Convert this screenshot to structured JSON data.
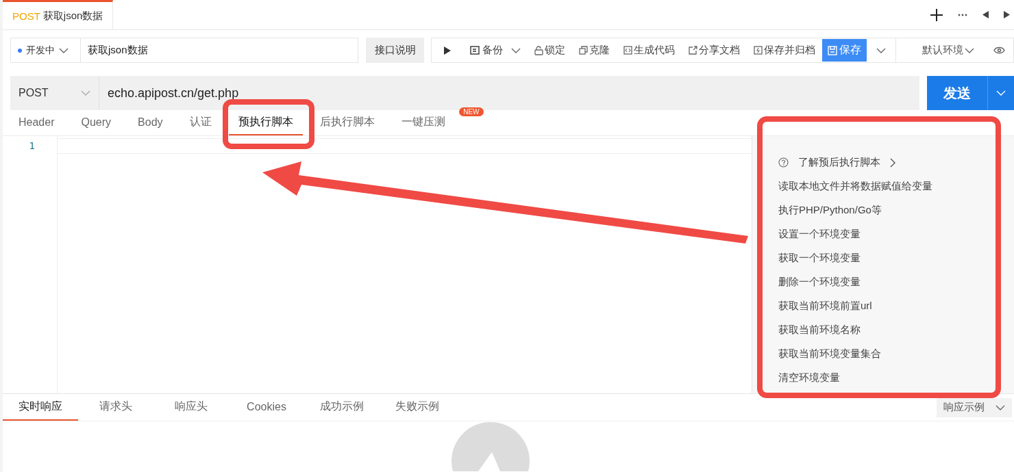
{
  "doc_tabs": [
    {
      "method": "POST",
      "title": "获取json数据",
      "selected": true
    }
  ],
  "status_select": {
    "value": "开发中"
  },
  "api_name": {
    "value": "获取json数据"
  },
  "doc_button": "接口说明",
  "toolbar": [
    {
      "kind": "run"
    },
    {
      "kind": "split",
      "label": "备份"
    },
    {
      "kind": "action",
      "label": "锁定"
    },
    {
      "kind": "action",
      "label": "克隆"
    },
    {
      "kind": "action",
      "label": "生成代码"
    },
    {
      "kind": "action",
      "label": "分享文档"
    },
    {
      "kind": "action",
      "label": "保存并归档"
    },
    {
      "kind": "primary",
      "label": "保存"
    },
    {
      "kind": "caret"
    },
    {
      "kind": "env",
      "label": "默认环境"
    },
    {
      "kind": "eye"
    }
  ],
  "method_select": {
    "value": "POST"
  },
  "url_field": {
    "value": "echo.apipost.cn/get.php"
  },
  "send_button": "发送",
  "request_tabs": [
    {
      "label": "Header",
      "selected": false
    },
    {
      "label": "Query",
      "selected": false
    },
    {
      "label": "Body",
      "selected": false
    },
    {
      "label": "认证",
      "selected": false
    },
    {
      "label": "预执行脚本",
      "selected": true
    },
    {
      "label": "后执行脚本",
      "selected": false
    },
    {
      "label": "一键压测",
      "selected": false,
      "badge": "NEW"
    }
  ],
  "editor": {
    "line_numbers": [
      "1"
    ]
  },
  "snippets": [
    {
      "kind": "help",
      "label": "了解预后执行脚本"
    },
    {
      "kind": "snippet",
      "label": "读取本地文件并将数据赋值给变量"
    },
    {
      "kind": "snippet",
      "label": "执行PHP/Python/Go等"
    },
    {
      "kind": "snippet",
      "label": "设置一个环境变量"
    },
    {
      "kind": "snippet",
      "label": "获取一个环境变量"
    },
    {
      "kind": "snippet",
      "label": "删除一个环境变量"
    },
    {
      "kind": "snippet",
      "label": "获取当前环境前置url"
    },
    {
      "kind": "snippet",
      "label": "获取当前环境名称"
    },
    {
      "kind": "snippet",
      "label": "获取当前环境变量集合"
    },
    {
      "kind": "snippet",
      "label": "清空环境变量"
    }
  ],
  "response_tabs": [
    {
      "label": "实时响应",
      "selected": true
    },
    {
      "label": "请求头",
      "selected": false
    },
    {
      "label": "响应头",
      "selected": false
    },
    {
      "label": "Cookies",
      "selected": false
    },
    {
      "label": "成功示例",
      "selected": false
    },
    {
      "label": "失败示例",
      "selected": false
    }
  ],
  "response_example_select": {
    "value": "响应示例"
  }
}
